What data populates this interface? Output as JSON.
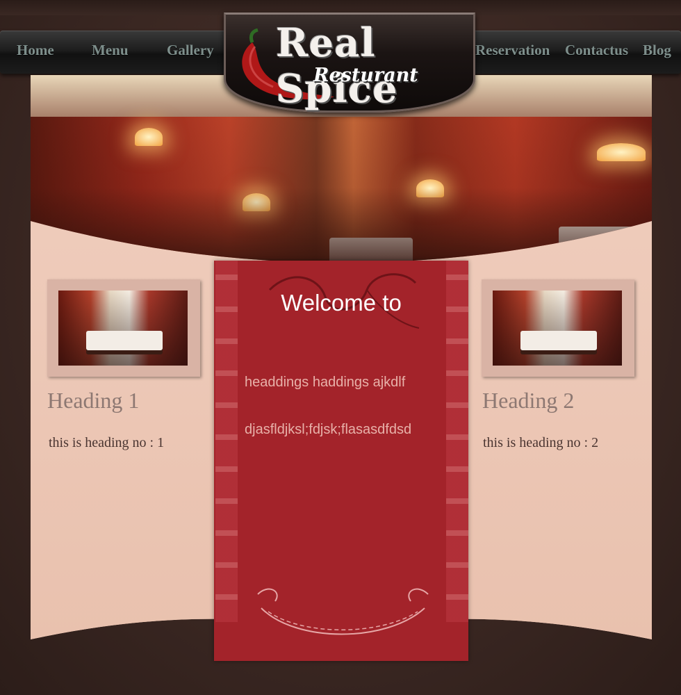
{
  "nav": {
    "left": [
      "Home",
      "Menu",
      "Gallery"
    ],
    "right": [
      "Reservation",
      "Contactus",
      "Blog"
    ]
  },
  "logo": {
    "title": "Real Spice",
    "subtitle": "Resturant"
  },
  "center": {
    "title": "Welcome to",
    "line1": "headdings  haddings ajkdlf",
    "line2": "djasfldjksl;fdjsk;flasasdfdsd"
  },
  "left_col": {
    "heading": "Heading 1",
    "text": "this is heading no : 1"
  },
  "right_col": {
    "heading": "Heading 2",
    "text": "this is heading no : 2"
  },
  "colors": {
    "accent_red": "#a3232a",
    "panel": "#eecab9",
    "nav_text": "#7e8f8c"
  }
}
